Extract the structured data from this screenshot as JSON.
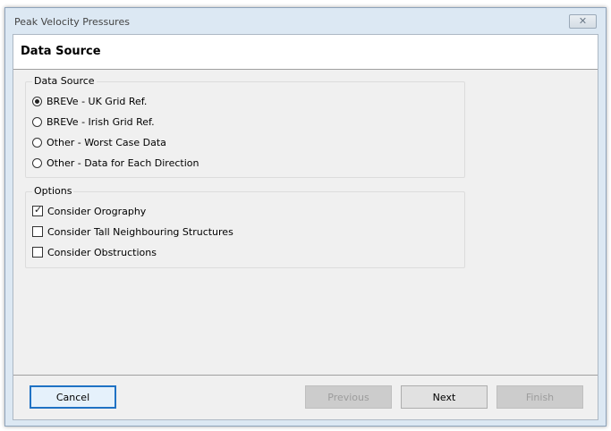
{
  "window": {
    "title": "Peak Velocity Pressures",
    "close_icon": "close-icon"
  },
  "header": {
    "title": "Data Source"
  },
  "data_source_group": {
    "label": "Data Source",
    "options": [
      {
        "label": "BREVe - UK Grid Ref.",
        "selected": true
      },
      {
        "label": "BREVe - Irish Grid Ref.",
        "selected": false
      },
      {
        "label": "Other - Worst Case Data",
        "selected": false
      },
      {
        "label": "Other - Data for Each Direction",
        "selected": false
      }
    ]
  },
  "options_group": {
    "label": "Options",
    "items": [
      {
        "label": "Consider Orography",
        "checked": true
      },
      {
        "label": "Consider Tall Neighbouring Structures",
        "checked": false
      },
      {
        "label": "Consider Obstructions",
        "checked": false
      }
    ]
  },
  "buttons": {
    "cancel": "Cancel",
    "previous": "Previous",
    "next": "Next",
    "finish": "Finish"
  },
  "colors": {
    "accent": "#1f72c4",
    "frame": "#dce8f3",
    "client": "#f0f0f0"
  }
}
